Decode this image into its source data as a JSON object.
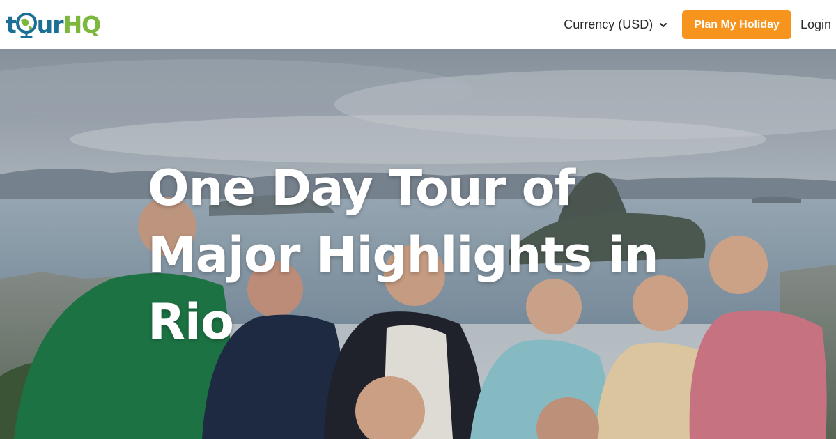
{
  "header": {
    "logo_text": "tourHQ",
    "currency_label": "Currency (USD)",
    "plan_button_label": "Plan My Holiday",
    "login_label": "Login"
  },
  "hero": {
    "title": "One Day Tour of Major Highlights in Rio"
  },
  "colors": {
    "brand_blue": "#1b6f97",
    "brand_green": "#7cb83c",
    "cta_orange": "#f7941d"
  },
  "icons": {
    "logo": "globe-icon",
    "currency_dropdown": "chevron-down-icon"
  }
}
